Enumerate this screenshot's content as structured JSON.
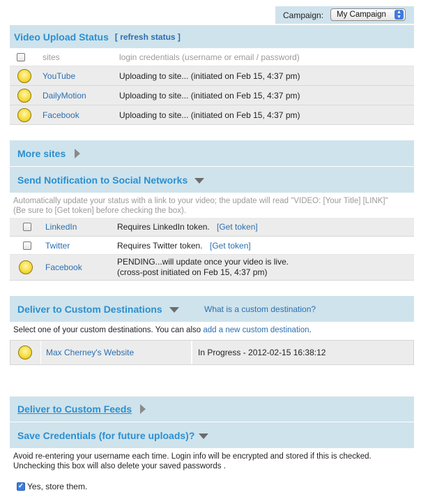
{
  "campaign": {
    "label": "Campaign:",
    "selected": "My Campaign"
  },
  "upload_status": {
    "title": "Video Upload Status",
    "refresh_label": "[ refresh status ]",
    "header_sites": "sites",
    "header_credentials": "login credentials (username or email / password)",
    "rows": [
      {
        "site": "YouTube",
        "status": "Uploading to site... (initiated on Feb 15, 4:37 pm)"
      },
      {
        "site": "DailyMotion",
        "status": "Uploading to site... (initiated on Feb 15, 4:37 pm)"
      },
      {
        "site": "Facebook",
        "status": "Uploading to site... (initiated on Feb 15, 4:37 pm)"
      }
    ]
  },
  "more_sites": {
    "title": "More sites"
  },
  "social": {
    "title": "Send Notification to Social Networks",
    "description_line1": "Automatically update your status with a link to your video; the update will read \"VIDEO: [Your Title] [LINK]\"",
    "description_line2": "(Be sure to [Get token] before checking the box).",
    "rows": [
      {
        "network": "LinkedIn",
        "status": "Requires LinkedIn token.",
        "token_link": "[Get token]"
      },
      {
        "network": "Twitter",
        "status": "Requires Twitter token.",
        "token_link": "[Get token]"
      },
      {
        "network": "Facebook",
        "status_line1": "PENDING...will update once your video is live.",
        "status_line2": "(cross-post initiated on Feb 15, 4:37 pm)"
      }
    ]
  },
  "custom_destinations": {
    "title": "Deliver to Custom Destinations",
    "help_link": "What is a custom destination?",
    "intro_text": "Select one of your custom destinations. You can also ",
    "add_link": "add a new custom destination",
    "intro_end": ".",
    "rows": [
      {
        "name": "Max Cherney's Website",
        "status": "In Progress - 2012-02-15 16:38:12"
      }
    ]
  },
  "custom_feeds": {
    "title": "Deliver to Custom Feeds"
  },
  "credentials": {
    "title": "Save Credentials (for future uploads)?",
    "note_line1": "Avoid re-entering your username each time. Login info will be encrypted and stored if this is checked.",
    "note_line2": "Unchecking this box will also delete your saved passwords .",
    "store_label": "Yes, store them.",
    "store_checked": true
  },
  "colors": {
    "header_bg": "#cfe3ec",
    "title_blue": "#2b8fd0",
    "link_blue": "#2b6fb0",
    "pending_yellow": "#f7dc3e"
  }
}
